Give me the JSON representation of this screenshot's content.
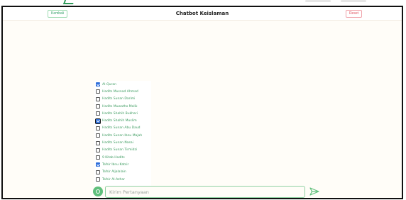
{
  "header": {
    "back_label": "Kembali",
    "title": "Chatbot Keislaman",
    "reset_label": "Reset"
  },
  "sources": [
    {
      "label": "Al-Quran",
      "checked": true
    },
    {
      "label": "Hadits Musnad Ahmad",
      "checked": false
    },
    {
      "label": "Hadits Sunan Darimi",
      "checked": false
    },
    {
      "label": "Hadits Muwatho Malik",
      "checked": false
    },
    {
      "label": "Hadits Shahih Bukhari",
      "checked": false
    },
    {
      "label": "Hadits Shahih Muslim",
      "checked": true,
      "focused": true
    },
    {
      "label": "Hadits Sunan Abu Daud",
      "checked": false
    },
    {
      "label": "Hadits Sunan Ibnu Majah",
      "checked": false
    },
    {
      "label": "Hadits Sunan Nasai",
      "checked": false
    },
    {
      "label": "Hadits Sunan Tirmidzi",
      "checked": false
    },
    {
      "label": "9 Kitab Hadits",
      "checked": false
    },
    {
      "label": "Tafsir Ibnu Katsir",
      "checked": true
    },
    {
      "label": "Tafsir Aljalalain",
      "checked": false
    },
    {
      "label": "Tafsir Al-Azhar",
      "checked": false
    }
  ],
  "composer": {
    "placeholder": "Kirim Pertanyaan",
    "value": "",
    "context_icon": "target-icon",
    "send_icon": "send-icon"
  },
  "colors": {
    "accent": "#3a9a5e",
    "reset": "#e0525f",
    "checkbox": "#2f6fdb"
  }
}
